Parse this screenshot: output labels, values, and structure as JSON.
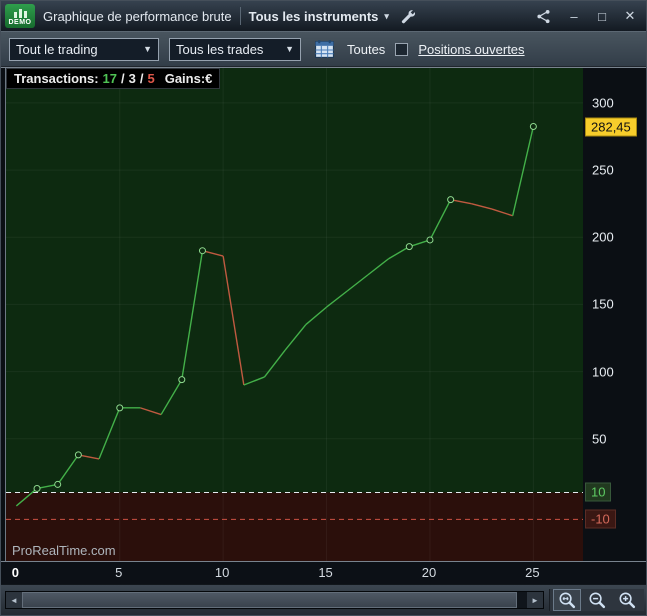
{
  "window": {
    "logo_text": "DEMO",
    "title": "Graphique de performance brute",
    "instrument_selector": "Tous les instruments"
  },
  "icons": {
    "caret_small": "▾",
    "caret_down": "▼",
    "minimize": "–",
    "maximize": "□",
    "close": "✕",
    "arrow_left": "◄",
    "arrow_right": "►"
  },
  "toolbar": {
    "trading_scope": "Tout le trading",
    "trades_filter": "Tous les trades",
    "period_label": "Toutes",
    "open_positions_label": "Positions ouvertes"
  },
  "stats_overlay": {
    "transactions_label": "Transactions:",
    "wins": "17",
    "neutral": "3",
    "losses": "5",
    "separator": "/",
    "gains_label": "Gains:€"
  },
  "watermark": "ProRealTime.com",
  "colors": {
    "line_up": "#43b049",
    "line_down": "#c05a40",
    "marker_stroke": "#8fd98f",
    "bg_positive": "#0d2a10",
    "bg_negative": "#2b0f0b",
    "upper_dash": "#e6ebf0",
    "lower_dash": "#cc5244",
    "grid": "rgba(255,255,255,0.05)"
  },
  "chart_data": {
    "type": "line",
    "xlabel": "",
    "ylabel": "",
    "x": [
      0,
      1,
      2,
      3,
      4,
      5,
      6,
      7,
      8,
      9,
      10,
      11,
      12,
      13,
      14,
      15,
      16,
      17,
      18,
      19,
      20,
      21,
      22,
      23,
      24,
      25
    ],
    "values": [
      0,
      13,
      16,
      38,
      35,
      73,
      73,
      68,
      94,
      190,
      186,
      90,
      96,
      116,
      135,
      148,
      160,
      172,
      184,
      193,
      198,
      228,
      225,
      221,
      216,
      282.45
    ],
    "marker_indices": [
      1,
      2,
      3,
      5,
      8,
      9,
      19,
      20,
      21,
      25
    ],
    "x_ticks": [
      0,
      5,
      10,
      15,
      20,
      25
    ],
    "y_ticks": [
      50,
      100,
      150,
      200,
      250,
      300
    ],
    "xlim": [
      -0.5,
      27.4
    ],
    "ylim": [
      -41,
      326
    ],
    "upper_threshold": 10,
    "lower_threshold": -10,
    "last_value": 282.45,
    "labels": {
      "last_value": "282,45",
      "upper_threshold": "10",
      "lower_threshold": "-10"
    },
    "grid": "faint",
    "legend_position": "none"
  }
}
